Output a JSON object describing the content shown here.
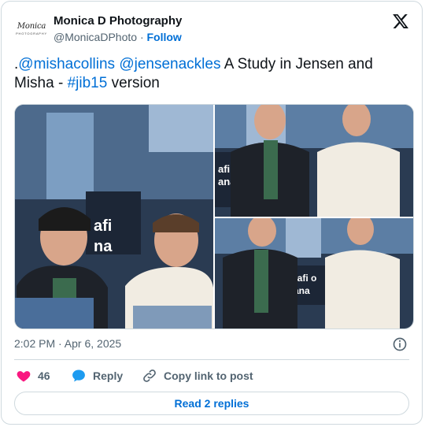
{
  "author": {
    "name": "Monica D Photography",
    "handle": "@MonicaDPhoto",
    "separator": "·",
    "follow_label": "Follow",
    "avatar_text": "Monica",
    "avatar_subtext": "PHOTOGRAPHY"
  },
  "tweet": {
    "prefix": ".",
    "mention1": "@mishacollins",
    "space1": " ",
    "mention2": "@jensenackles",
    "text_mid": " A Study in Jensen and Misha - ",
    "hashtag": "#jib15",
    "text_end": " version"
  },
  "photos": [
    {
      "alt": "photo-1",
      "sign_text1": "afi",
      "sign_text2": "na"
    },
    {
      "alt": "photo-2",
      "sign_text1": "afi",
      "sign_text2": "ana"
    },
    {
      "alt": "photo-3",
      "sign_text1": "rafi o",
      "sign_text2": "ana"
    }
  ],
  "meta": {
    "timestamp": "2:02 PM · Apr 6, 2025"
  },
  "actions": {
    "like_count": "46",
    "reply_label": "Reply",
    "copy_label": "Copy link to post"
  },
  "read_replies_label": "Read 2 replies",
  "colors": {
    "link": "#006fd6",
    "heart": "#f91880",
    "reply_bubble": "#1d9bf0",
    "border": "#cfd9de"
  }
}
